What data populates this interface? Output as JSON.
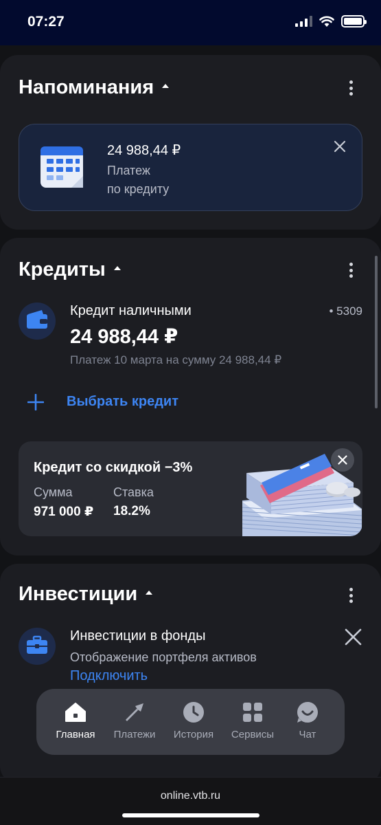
{
  "status_bar": {
    "time": "07:27"
  },
  "reminders": {
    "title": "Напоминания",
    "item": {
      "amount": "24 988,44 ₽",
      "line1": "Платеж",
      "line2": "по кредиту"
    }
  },
  "credits": {
    "title": "Кредиты",
    "credit": {
      "name": "Кредит наличными",
      "card": "• 5309",
      "amount": "24 988,44 ₽",
      "subtitle": "Платеж 10 марта на сумму 24 988,44 ₽"
    },
    "choose_label": "Выбрать кредит",
    "promo": {
      "title": "Кредит со скидкой −3%",
      "sum_label": "Сумма",
      "sum_value": "971 000 ₽",
      "rate_label": "Ставка",
      "rate_value": "18.2%"
    }
  },
  "investments": {
    "title": "Инвестиции",
    "item": {
      "title": "Инвестиции в фонды",
      "subtitle": "Отображение портфеля активов",
      "link": "Подключить"
    }
  },
  "nav": {
    "items": [
      {
        "label": "Главная",
        "icon": "home-icon",
        "active": true
      },
      {
        "label": "Платежи",
        "icon": "payments-arrow-icon",
        "active": false
      },
      {
        "label": "История",
        "icon": "clock-icon",
        "active": false
      },
      {
        "label": "Сервисы",
        "icon": "grid-icon",
        "active": false
      },
      {
        "label": "Чат",
        "icon": "chat-icon",
        "active": false
      }
    ]
  },
  "browser": {
    "url": "online.vtb.ru"
  },
  "colors": {
    "accent": "#3d85f3",
    "card_bg": "#1c1d22",
    "page_bg": "#121316",
    "status_bg": "#020a2e"
  }
}
